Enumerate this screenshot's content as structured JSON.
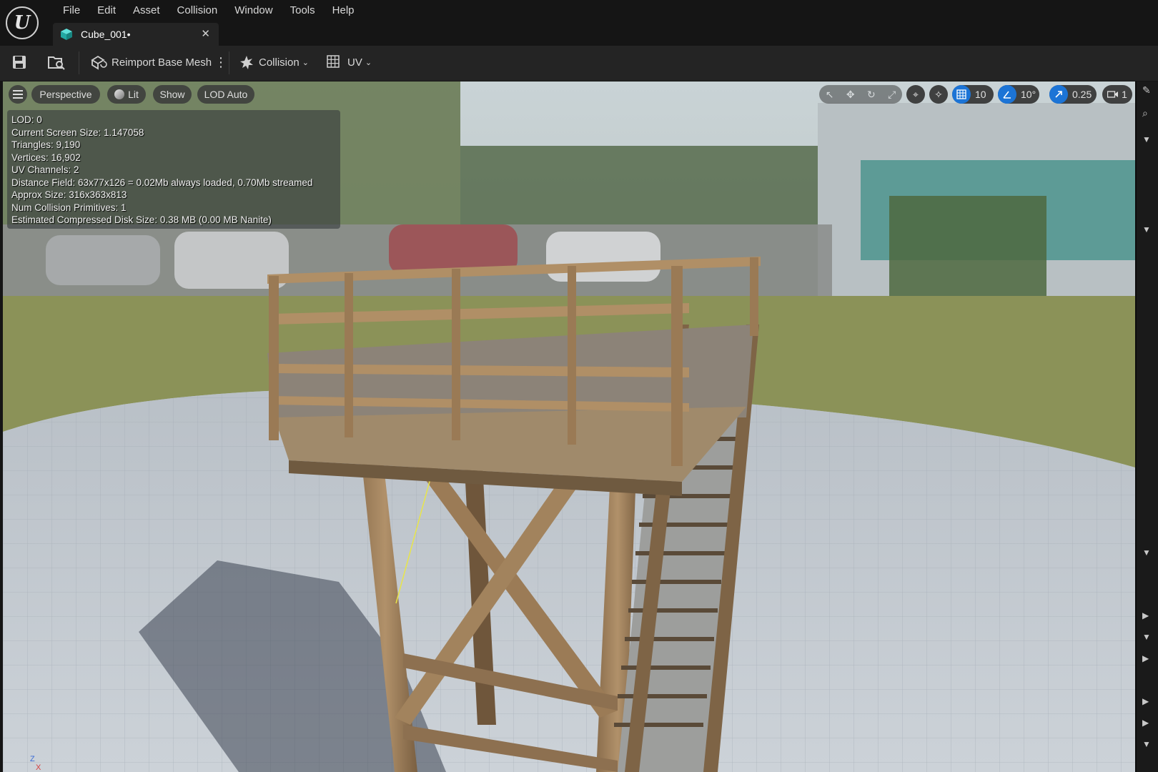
{
  "menu": [
    "File",
    "Edit",
    "Asset",
    "Collision",
    "Window",
    "Tools",
    "Help"
  ],
  "tab": {
    "title": "Cube_001•"
  },
  "toolbar": {
    "reimport_label": "Reimport Base Mesh",
    "collision_label": "Collision",
    "uv_label": "UV"
  },
  "viewport": {
    "perspective_label": "Perspective",
    "lit_label": "Lit",
    "show_label": "Show",
    "lod_label": "LOD Auto",
    "grid_snap": "10",
    "rotation_snap": "10°",
    "scale_snap": "0.25",
    "camera_speed": "1"
  },
  "stats": [
    "LOD:  0",
    "Current Screen Size:  1.147058",
    "Triangles:  9,190",
    "Vertices:  16,902",
    "UV Channels:  2",
    "Distance Field:  63x77x126 = 0.02Mb always loaded, 0.70Mb streamed",
    "Approx Size: 316x363x813",
    "Num Collision Primitives:  1",
    "Estimated Compressed Disk Size: 0.38 MB (0.00 MB Nanite)"
  ],
  "axis": {
    "z": "Z",
    "x": "X"
  },
  "colors": {
    "accent_blue": "#1c74d6",
    "tab_icon": "#2fc7c0",
    "background": "#151515"
  }
}
